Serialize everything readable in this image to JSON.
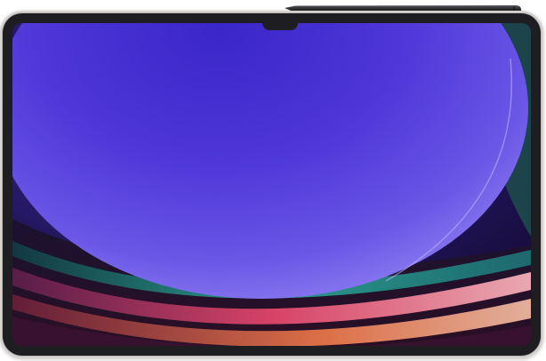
{
  "device": {
    "type": "tablet",
    "accessory": "stylus",
    "colors": {
      "frame": "#1e1e22",
      "screen_purple": "#5a42d6",
      "accent_teal": "#2f9a8c",
      "accent_pink": "#e0456a",
      "accent_orange": "#f07a4a"
    }
  }
}
